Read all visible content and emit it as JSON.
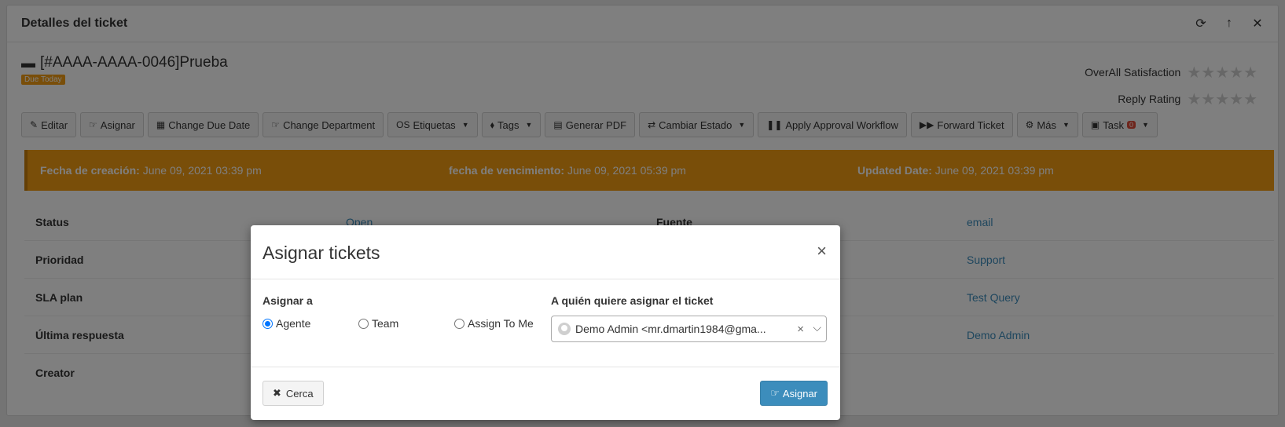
{
  "panel": {
    "title": "Detalles del ticket",
    "tools": {
      "refresh": "⟳",
      "up": "↑",
      "close": "✕"
    }
  },
  "ticket": {
    "icon": "▬",
    "title": "[#AAAA-AAAA-0046]Prueba",
    "badge": "Due Today"
  },
  "ratings": {
    "overall_label": "OverAll Satisfaction",
    "reply_label": "Reply Rating",
    "stars": "★★★★★"
  },
  "toolbar": [
    {
      "icon": "✎",
      "label": "Editar",
      "caret": ""
    },
    {
      "icon": "☞",
      "label": "Asignar",
      "caret": ""
    },
    {
      "icon": "▦",
      "label": "Change Due Date",
      "caret": ""
    },
    {
      "icon": "☞",
      "label": "Change Department",
      "caret": ""
    },
    {
      "icon": "OS",
      "label": "Etiquetas",
      "caret": "▼"
    },
    {
      "icon": "⬧",
      "label": "Tags",
      "caret": "▼"
    },
    {
      "icon": "▤",
      "label": "Generar PDF",
      "caret": ""
    },
    {
      "icon": "⇄",
      "label": "Cambiar Estado",
      "caret": "▼"
    },
    {
      "icon": "❚❚",
      "label": "Apply Approval Workflow",
      "caret": ""
    },
    {
      "icon": "▶▶",
      "label": "Forward Ticket",
      "caret": ""
    },
    {
      "icon": "⚙",
      "label": "Más",
      "caret": "▼"
    },
    {
      "icon": "▣",
      "label": "Task",
      "badge": "0",
      "caret": "▼"
    }
  ],
  "dates": {
    "created_label": "Fecha de creación:",
    "created_value": "June 09, 2021 03:39 pm",
    "due_label": "fecha de vencimiento:",
    "due_value": "June 09, 2021 05:39 pm",
    "updated_label": "Updated Date:",
    "updated_value": "June 09, 2021 03:39 pm"
  },
  "details": [
    {
      "l1": "Status",
      "v1": "Open",
      "l2": "Fuente",
      "v2": "email"
    },
    {
      "l1": "Prioridad",
      "v1": "",
      "l2": "",
      "v2": "Support"
    },
    {
      "l1": "SLA plan",
      "v1": "",
      "l2": "",
      "v2": "Test Query"
    },
    {
      "l1": "Última respuesta",
      "v1": "",
      "l2": "",
      "v2": "Demo Admin"
    },
    {
      "l1": "Creator",
      "v1": "",
      "l2": "",
      "v2": ""
    }
  ],
  "modal": {
    "title": "Asignar tickets",
    "close": "×",
    "assign_to_label": "Asignar a",
    "options": [
      "Agente",
      "Team",
      "Assign To Me"
    ],
    "selected_option": "Agente",
    "who_label": "A quién quiere asignar el ticket",
    "select_value": "Demo Admin <mr.dmartin1984@gma...",
    "select_clear": "×",
    "select_caret": "⌵",
    "close_button_icon": "✖",
    "close_button_label": "Cerca",
    "assign_button_icon": "☞",
    "assign_button_label": "Asignar"
  }
}
